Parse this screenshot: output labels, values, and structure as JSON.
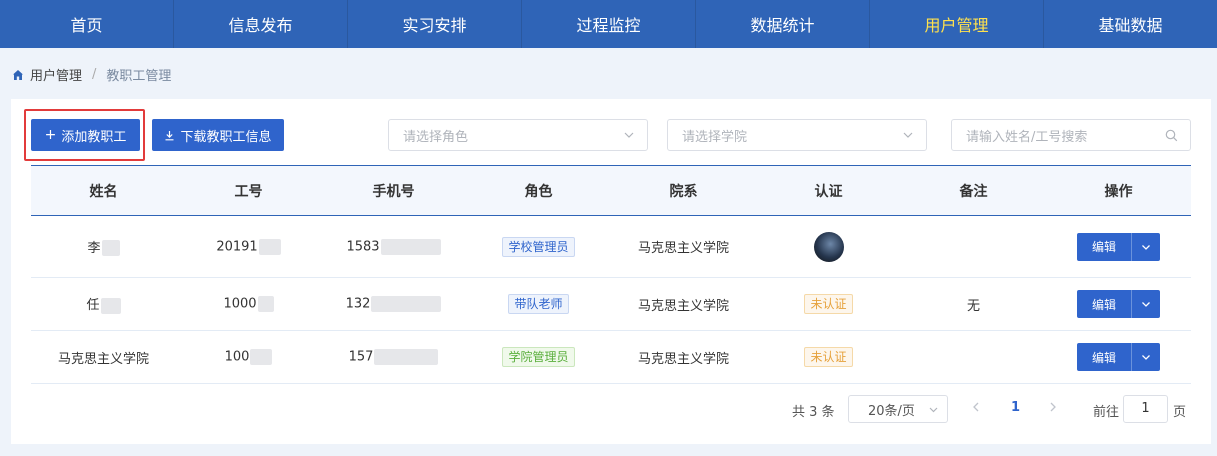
{
  "nav": {
    "items": [
      {
        "label": "首页"
      },
      {
        "label": "信息发布"
      },
      {
        "label": "实习安排"
      },
      {
        "label": "过程监控"
      },
      {
        "label": "数据统计"
      },
      {
        "label": "用户管理"
      },
      {
        "label": "基础数据"
      }
    ],
    "active_index": 5,
    "active_color": "#ffe14d",
    "bg_color": "#2f64b7"
  },
  "breadcrumb": {
    "icon": "home-icon",
    "root": "用户管理",
    "separator": "/",
    "current": "教职工管理"
  },
  "toolbar": {
    "add_label": "添加教职工",
    "add_icon": "plus-icon",
    "download_label": "下载教职工信息",
    "download_icon": "download-icon",
    "role_placeholder": "请选择角色",
    "college_placeholder": "请选择学院",
    "search_placeholder": "请输入姓名/工号搜索",
    "accent_color": "#2f64cc",
    "highlight_color": "#e23b3b"
  },
  "table": {
    "headers": [
      "姓名",
      "工号",
      "手机号",
      "角色",
      "院系",
      "认证",
      "备注",
      "操作"
    ],
    "rows": [
      {
        "name": "李",
        "id": "20191",
        "phone": "1583",
        "role": "学校管理员",
        "role_style": "blue",
        "dept": "马克思主义学院",
        "auth": "",
        "auth_type": "avatar",
        "note": "",
        "op": "编辑"
      },
      {
        "name": "任",
        "id": "1000",
        "phone": "132",
        "role": "带队老师",
        "role_style": "blue",
        "dept": "马克思主义学院",
        "auth": "未认证",
        "auth_type": "tag",
        "note": "无",
        "op": "编辑"
      },
      {
        "name": "马克思主义学院",
        "id": "100",
        "phone": "157",
        "role": "学院管理员",
        "role_style": "green",
        "dept": "马克思主义学院",
        "auth": "未认证",
        "auth_type": "tag",
        "note": "",
        "op": "编辑"
      }
    ]
  },
  "pager": {
    "total": "共 3 条",
    "size": "20条/页",
    "current_page": "1",
    "goto_label": "前往",
    "goto_value": "1",
    "page_unit": "页"
  }
}
